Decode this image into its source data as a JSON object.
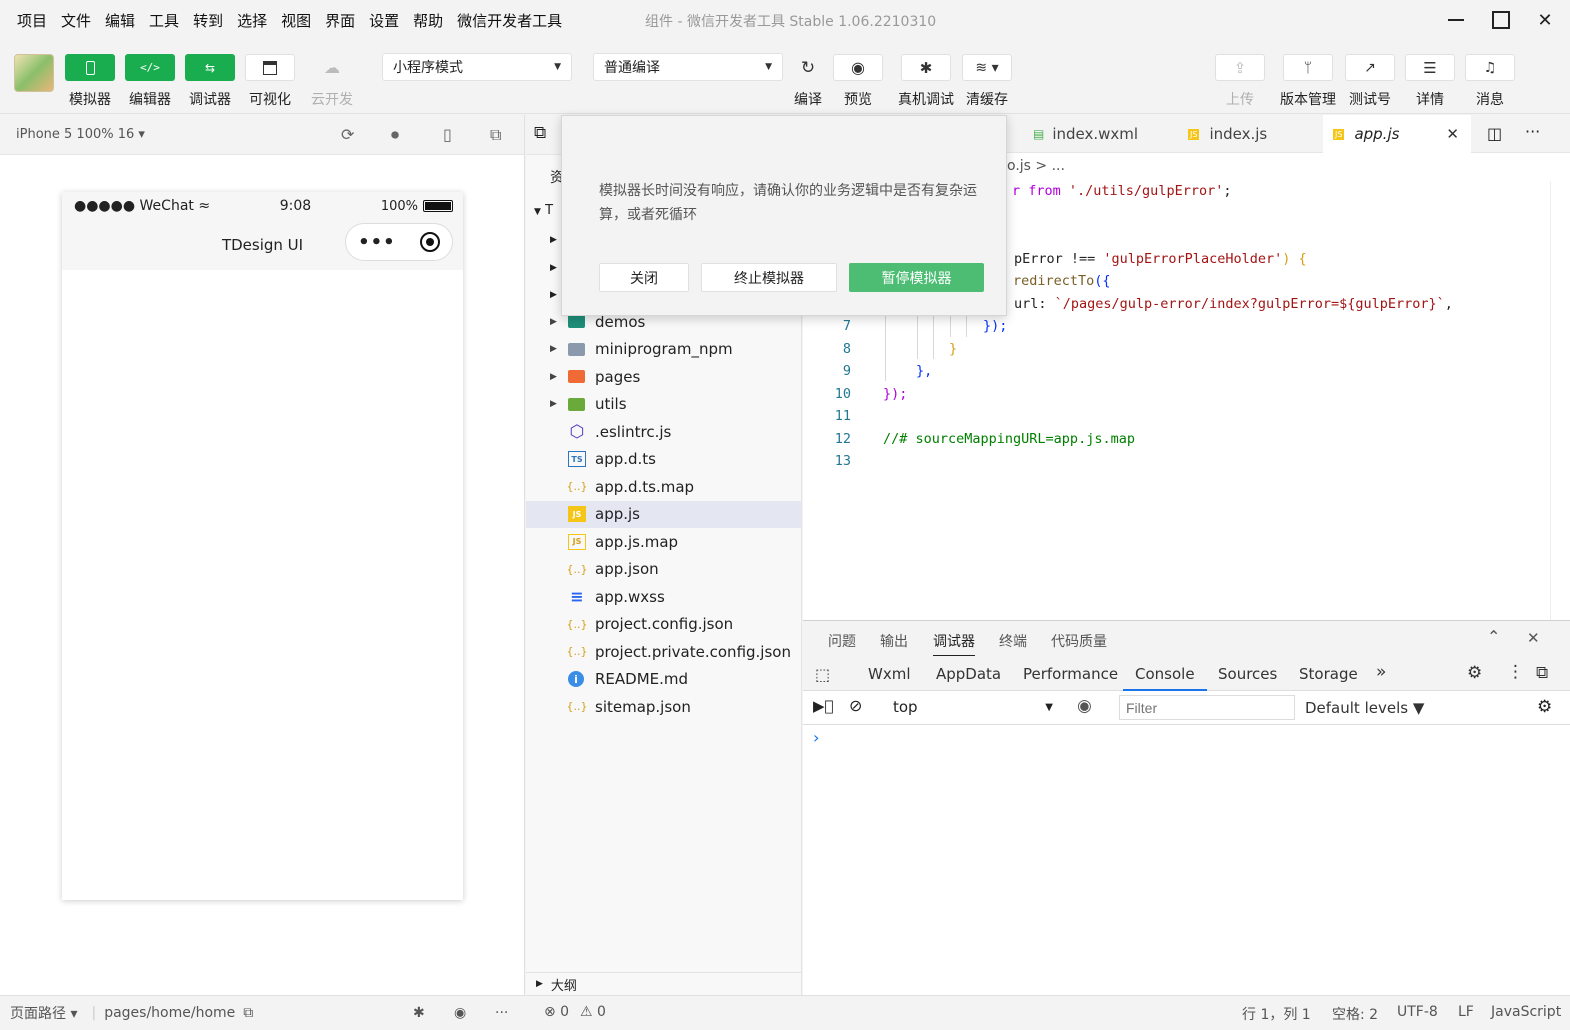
{
  "menu": [
    "项目",
    "文件",
    "编辑",
    "工具",
    "转到",
    "选择",
    "视图",
    "界面",
    "设置",
    "帮助",
    "微信开发者工具"
  ],
  "window_title": "组件 - 微信开发者工具 Stable 1.06.2210310",
  "toolbar": {
    "simulator": "模拟器",
    "editor": "编辑器",
    "debugger": "调试器",
    "visual": "可视化",
    "cloud": "云开发",
    "mode_select": "小程序模式",
    "compile_select": "普通编译",
    "compile": "编译",
    "preview": "预览",
    "real_debug": "真机调试",
    "clear_cache": "清缓存",
    "upload": "上传",
    "version": "版本管理",
    "test_account": "测试号",
    "details": "详情",
    "messages": "消息"
  },
  "simulator": {
    "device": "iPhone 5 100% 16 ▾",
    "carrier": "●●●●● WeChat",
    "time": "9:08",
    "battery": "100%",
    "page_title": "TDesign UI"
  },
  "sim_footer": {
    "path_label": "页面路径",
    "path": "pages/home/home"
  },
  "explorer": {
    "header_char": "资",
    "root_char": "T",
    "items": [
      {
        "name": "demos",
        "type": "folder-teal",
        "arrow": true
      },
      {
        "name": "miniprogram_npm",
        "type": "folder",
        "arrow": true
      },
      {
        "name": "pages",
        "type": "folder-orange",
        "arrow": true
      },
      {
        "name": "utils",
        "type": "folder-green",
        "arrow": true
      },
      {
        "name": ".eslintrc.js",
        "type": "eslint",
        "arrow": false
      },
      {
        "name": "app.d.ts",
        "type": "ts",
        "arrow": false
      },
      {
        "name": "app.d.ts.map",
        "type": "json",
        "arrow": false
      },
      {
        "name": "app.js",
        "type": "js",
        "arrow": false
      },
      {
        "name": "app.js.map",
        "type": "jsmap",
        "arrow": false
      },
      {
        "name": "app.json",
        "type": "json",
        "arrow": false
      },
      {
        "name": "app.wxss",
        "type": "css",
        "arrow": false
      },
      {
        "name": "project.config.json",
        "type": "json",
        "arrow": false
      },
      {
        "name": "project.private.config.json",
        "type": "json",
        "arrow": false
      },
      {
        "name": "README.md",
        "type": "info",
        "arrow": false
      },
      {
        "name": "sitemap.json",
        "type": "json",
        "arrow": false
      }
    ],
    "outline": "大纲"
  },
  "editor": {
    "tabs": [
      "index.wxml",
      "index.js",
      "app.js"
    ],
    "breadcrumb": "o.js > ...",
    "code": {
      "l1a": "r ",
      "l1b": "from",
      "l1c": " './utils/gulpError'",
      "l1d": ";",
      "l4a": "pError !== ",
      "l4b": "'gulpErrorPlaceHolder'",
      "l4c": ") {",
      "l5a": "redirectTo",
      "l5b": "({",
      "l6a": "url: ",
      "l6b": "`/pages/gulp-error/index?gulpError=${gulpError}`",
      "l6c": ",",
      "l7": "});",
      "l8": "}",
      "l9": "},",
      "l10": "});",
      "l12": "//# sourceMappingURL=app.js.map"
    },
    "line_numbers": [
      "7",
      "8",
      "9",
      "10",
      "11",
      "12",
      "13"
    ]
  },
  "debug": {
    "top_tabs": [
      "问题",
      "输出",
      "调试器",
      "终端",
      "代码质量"
    ],
    "dev_tabs": [
      "Wxml",
      "AppData",
      "Performance",
      "Console",
      "Sources",
      "Storage"
    ],
    "more": "»",
    "context": "top",
    "filter_placeholder": "Filter",
    "levels": "Default levels ▼",
    "prompt": "›"
  },
  "dialog": {
    "message": "模拟器长时间没有响应，请确认你的业务逻辑中是否有复杂运算，或者死循环",
    "close": "关闭",
    "stop": "终止模拟器",
    "pause": "暂停模拟器"
  },
  "statusbar": {
    "errors": "⊗ 0",
    "warnings": "⚠ 0",
    "position": "行 1，列 1",
    "spaces": "空格: 2",
    "encoding": "UTF-8",
    "eol": "LF",
    "language": "JavaScript"
  },
  "colors": {
    "accent_green": "#1aad50",
    "dialog_primary": "#4dbd74",
    "selection": "#e4e6f1"
  }
}
